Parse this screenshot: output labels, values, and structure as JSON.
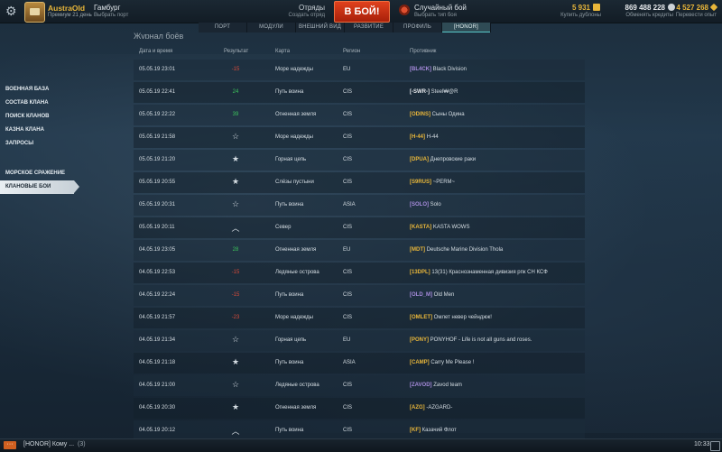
{
  "header": {
    "player_name": "AustraOld",
    "premium_text": "Премиум 21 день",
    "port_name": "Гамбург",
    "port_sub": "Выбрать порт",
    "squad_label": "Отряды",
    "squad_sub": "Создать отряд",
    "battle_button": "В БОЙ!",
    "mode_label": "Случайный бой",
    "mode_sub": "Выбрать тип боя",
    "doubloons": "5 931",
    "doubloons_sub": "Купить дублоны",
    "credits": "869 488 228",
    "credits_sub": "Обменять кредиты",
    "free_xp": "4 527 268",
    "free_xp_sub": "Перевести опыт",
    "colors": {
      "gold": "#e8b63a",
      "credits": "#e6e9ec",
      "free_xp": "#e8b63a",
      "battle": "#d2361a"
    }
  },
  "tabs": [
    {
      "label": "ПОРТ"
    },
    {
      "label": "МОДУЛИ"
    },
    {
      "label": "ВНЕШНИЙ ВИД"
    },
    {
      "label": "РАЗВИТИЕ"
    },
    {
      "label": "ПРОФИЛЬ"
    },
    {
      "label": "[HONOR]",
      "active": true
    }
  ],
  "sidebar": {
    "group1": [
      {
        "label": "ВОЕННАЯ БАЗА"
      },
      {
        "label": "СОСТАВ КЛАНА"
      },
      {
        "label": "ПОИСК КЛАНОВ"
      },
      {
        "label": "КАЗНА КЛАНА"
      },
      {
        "label": "ЗАПРОСЫ"
      }
    ],
    "group2": [
      {
        "label": "МОРСКОЕ СРАЖЕНИЕ"
      },
      {
        "label": "КЛАНОВЫЕ БОИ",
        "active": true
      }
    ]
  },
  "journal": {
    "title": "Журнал боёв",
    "columns": [
      "Дата и время",
      "Результат",
      "Карта",
      "Регион",
      "Противник"
    ],
    "rows": [
      {
        "date": "05.05.19 23:01",
        "result": "-15",
        "result_type": "loss",
        "map": "Море надежды",
        "region": "EU",
        "tag": "[BL4CK]",
        "tag_color": "#a78bdc",
        "name": "Black Division"
      },
      {
        "date": "05.05.19 22:41",
        "result": "24",
        "result_type": "win",
        "map": "Путь воина",
        "region": "CIS",
        "tag": "[-SWR-]",
        "tag_color": "#e6e9ec",
        "name": "Steel₩@R"
      },
      {
        "date": "05.05.19 22:22",
        "result": "39",
        "result_type": "win",
        "map": "Огненная земля",
        "region": "CIS",
        "tag": "[ODINS]",
        "tag_color": "#e8b63a",
        "name": "Сыны Одина"
      },
      {
        "date": "05.05.19 21:58",
        "result": "☆",
        "result_type": "star",
        "map": "Море надежды",
        "region": "CIS",
        "tag": "[H-44]",
        "tag_color": "#e8b63a",
        "name": "H-44"
      },
      {
        "date": "05.05.19 21:20",
        "result": "★",
        "result_type": "star",
        "map": "Горная цепь",
        "region": "CIS",
        "tag": "[DPUA]",
        "tag_color": "#e8b63a",
        "name": "Днепровские раки"
      },
      {
        "date": "05.05.19 20:55",
        "result": "★",
        "result_type": "star",
        "map": "Слёзы пустыни",
        "region": "CIS",
        "tag": "[S9RUS]",
        "tag_color": "#e8b63a",
        "name": "~PERM~"
      },
      {
        "date": "05.05.19 20:31",
        "result": "☆",
        "result_type": "star",
        "map": "Путь воина",
        "region": "ASIA",
        "tag": "[SOLO]",
        "tag_color": "#a78bdc",
        "name": "Solo"
      },
      {
        "date": "05.05.19 20:11",
        "result": "︿",
        "result_type": "chevron",
        "map": "Север",
        "region": "CIS",
        "tag": "[KASTA]",
        "tag_color": "#e8b63a",
        "name": "KASTA WOWS"
      },
      {
        "date": "04.05.19 23:05",
        "result": "28",
        "result_type": "win",
        "map": "Огненная земля",
        "region": "EU",
        "tag": "[MDT]",
        "tag_color": "#e8b63a",
        "name": "Deutsche Marine Division Thola"
      },
      {
        "date": "04.05.19 22:53",
        "result": "-15",
        "result_type": "loss",
        "map": "Ледяные острова",
        "region": "CIS",
        "tag": "[13DPL]",
        "tag_color": "#e8b63a",
        "name": "13(31) Краснознаменная дивизия рпк СН КСФ"
      },
      {
        "date": "04.05.19 22:24",
        "result": "-15",
        "result_type": "loss",
        "map": "Путь воина",
        "region": "CIS",
        "tag": "[OLD_M]",
        "tag_color": "#a78bdc",
        "name": "Old Men"
      },
      {
        "date": "04.05.19 21:57",
        "result": "-23",
        "result_type": "loss",
        "map": "Море надежды",
        "region": "CIS",
        "tag": "[OMLET]",
        "tag_color": "#e8b63a",
        "name": "Омлет невер чейнджж!"
      },
      {
        "date": "04.05.19 21:34",
        "result": "☆",
        "result_type": "star",
        "map": "Горная цепь",
        "region": "EU",
        "tag": "[PONY]",
        "tag_color": "#e8b63a",
        "name": "PONYHOF - Life is not all guns and roses."
      },
      {
        "date": "04.05.19 21:18",
        "result": "★",
        "result_type": "star",
        "map": "Путь воина",
        "region": "ASIA",
        "tag": "[CAMP]",
        "tag_color": "#e8b63a",
        "name": "Carry Me Please !"
      },
      {
        "date": "04.05.19 21:00",
        "result": "☆",
        "result_type": "star",
        "map": "Ледяные острова",
        "region": "CIS",
        "tag": "[ZAVOD]",
        "tag_color": "#a78bdc",
        "name": "Zavod team"
      },
      {
        "date": "04.05.19 20:30",
        "result": "★",
        "result_type": "star",
        "map": "Огненная земля",
        "region": "CIS",
        "tag": "[AZG]",
        "tag_color": "#e8b63a",
        "name": "-AZGARD-"
      },
      {
        "date": "04.05.19 20:12",
        "result": "︿",
        "result_type": "chevron",
        "map": "Путь воина",
        "region": "CIS",
        "tag": "[KF]",
        "tag_color": "#e8b63a",
        "name": "Казачий Флот"
      }
    ]
  },
  "bottom": {
    "chat_button": "···",
    "chat_text": "[HONOR] Кому ...",
    "chat_count": "(3)",
    "clock": "10:33"
  }
}
